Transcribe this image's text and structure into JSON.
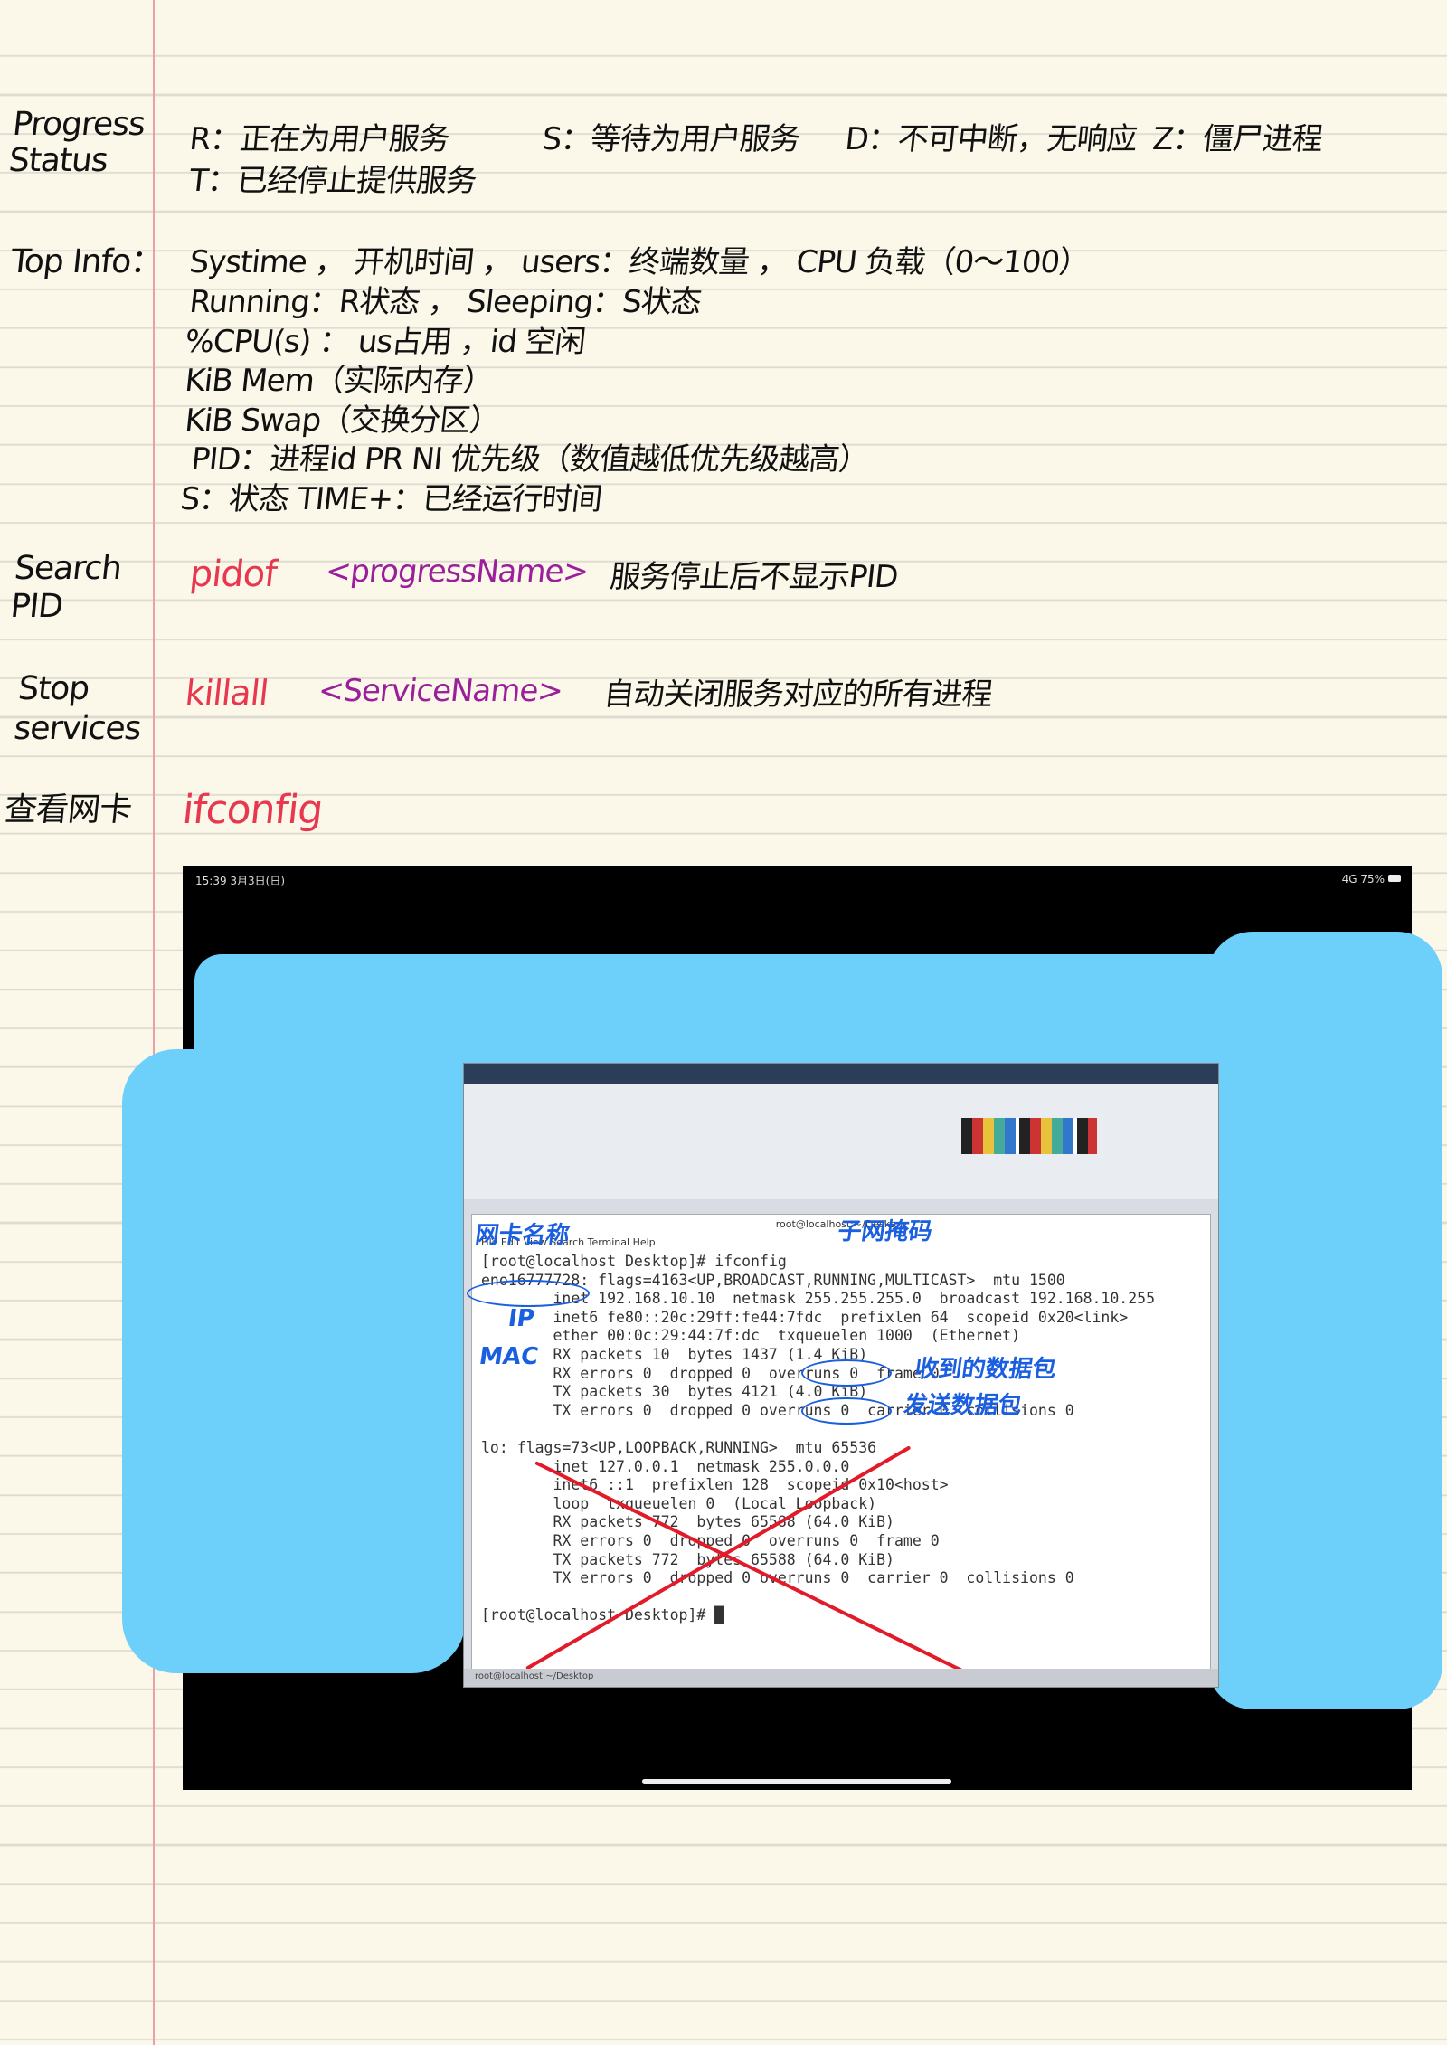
{
  "sections": {
    "progress_status": {
      "label": "Progress Status",
      "line1": [
        "R：正在为用户服务",
        "S：等待为用户服务",
        "D：不可中断，无响应",
        "Z：僵尸进程"
      ],
      "line2": "T：已经停止提供服务"
    },
    "top_info": {
      "label": "Top Info：",
      "lines": [
        "Systime ， 开机时间 ， users：终端数量 ， CPU 负载（0～100）",
        "Running：R状态 ， Sleeping：S状态",
        "%CPU(s) ： us占用 ，id 空闲",
        "KiB Mem（实际内存）",
        "KiB Swap（交换分区）",
        "PID：进程id   PR NI 优先级（数值越低优先级越高）",
        "S：状态   TIME+：已经运行时间"
      ]
    },
    "search_pid": {
      "label": "Search PID",
      "command": "pidof",
      "arg": "<progressName>",
      "note": "服务停止后不显示PID"
    },
    "stop_services": {
      "label": "Stop services",
      "command": "killall",
      "arg": "<ServiceName>",
      "note": "自动关闭服务对应的所有进程"
    },
    "nic": {
      "label": "查看网卡",
      "command": "ifconfig"
    }
  },
  "screenshot": {
    "status_time": "15:39  3月3日(日)",
    "status_right": "4G  75%",
    "terminal_title": "root@localhost:~/Desktop",
    "terminal_menu": "File  Edit  View  Search  Terminal  Help",
    "taskbar_item": "root@localhost:~/Desktop",
    "terminal_lines": [
      "[root@localhost Desktop]# ifconfig",
      "eno16777728: flags=4163<UP,BROADCAST,RUNNING,MULTICAST>  mtu 1500",
      "        inet 192.168.10.10  netmask 255.255.255.0  broadcast 192.168.10.255",
      "        inet6 fe80::20c:29ff:fe44:7fdc  prefixlen 64  scopeid 0x20<link>",
      "        ether 00:0c:29:44:7f:dc  txqueuelen 1000  (Ethernet)",
      "        RX packets 10  bytes 1437 (1.4 KiB)",
      "        RX errors 0  dropped 0  overruns 0  frame 0",
      "        TX packets 30  bytes 4121 (4.0 KiB)",
      "        TX errors 0  dropped 0 overruns 0  carrier 0  collisions 0",
      "",
      "lo: flags=73<UP,LOOPBACK,RUNNING>  mtu 65536",
      "        inet 127.0.0.1  netmask 255.0.0.0",
      "        inet6 ::1  prefixlen 128  scopeid 0x10<host>",
      "        loop  txqueuelen 0  (Local Loopback)",
      "        RX packets 772  bytes 65588 (64.0 KiB)",
      "        RX errors 0  dropped 0  overruns 0  frame 0",
      "        TX packets 772  bytes 65588 (64.0 KiB)",
      "        TX errors 0  dropped 0 overruns 0  carrier 0  collisions 0",
      "",
      "[root@localhost Desktop]# █"
    ],
    "annotations": {
      "nic_name": "网卡名称",
      "netmask": "子网掩码",
      "ip": "IP",
      "mac": "MAC",
      "rx": "收到的数据包",
      "tx": "发送数据包"
    }
  },
  "colors": {
    "annotation_blue": "#1a5fe0",
    "highlight_blue": "#6dd0fb",
    "red": "#e8384f",
    "purple": "#9b1f9b"
  }
}
